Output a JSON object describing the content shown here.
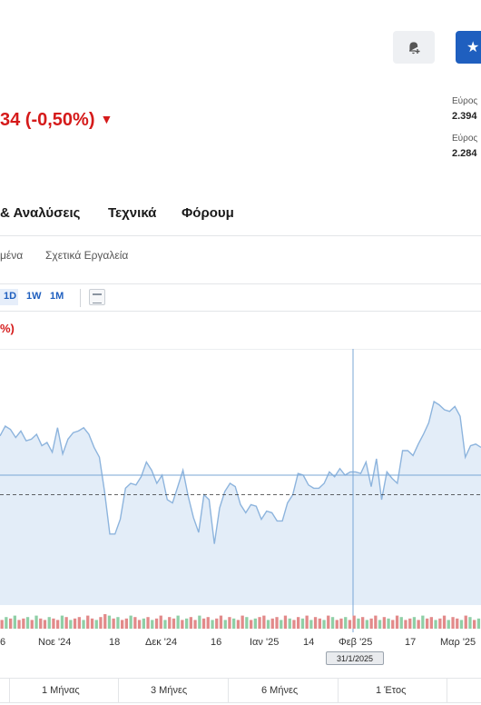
{
  "header": {
    "price_change": "34 (-0,50%)",
    "alert_icon": "bell-plus-icon",
    "watchlist_icon": "star-icon"
  },
  "side_stats": [
    {
      "label": "Εύρος",
      "value": "2.394"
    },
    {
      "label": "Εύρος",
      "value": "2.284"
    }
  ],
  "tabs": [
    "& Αναλύσεις",
    "Τεχνικά",
    "Φόρουμ"
  ],
  "subtabs": [
    "μένα",
    "Σχετικά Εργαλεία"
  ],
  "timeframes": [
    "1D",
    "1W",
    "1M"
  ],
  "chart_header": {
    "pct": "%)"
  },
  "crosshair_date": "31/1/2025",
  "x_axis": [
    "6",
    "Νοε '24",
    "18",
    "Δεκ '24",
    "16",
    "Ιαν '25",
    "14",
    "Φεβ '25",
    "17",
    "Μαρ '25"
  ],
  "ranges": [
    "1 Μήνας",
    "3 Μήνες",
    "6 Μήνες",
    "1 Έτος"
  ],
  "colors": {
    "up": "#2e9e5b",
    "down": "#d51a1a",
    "accent": "#1f5fbf",
    "line": "#7aa7d6"
  },
  "chart_data": {
    "type": "area",
    "title": "",
    "xlabel": "",
    "ylabel": "",
    "grid": false,
    "values": [
      69,
      75,
      73,
      68,
      72,
      66,
      67,
      70,
      63,
      65,
      59,
      74,
      58,
      67,
      71,
      72,
      74,
      70,
      62,
      56,
      35,
      9,
      9,
      18,
      37,
      40,
      39,
      44,
      53,
      48,
      40,
      45,
      30,
      28,
      38,
      48,
      32,
      19,
      10,
      33,
      30,
      3,
      25,
      35,
      40,
      38,
      27,
      22,
      27,
      26,
      18,
      23,
      22,
      17,
      17,
      28,
      33,
      46,
      45,
      39,
      37,
      37,
      40,
      47,
      44,
      49,
      45,
      47,
      47,
      46,
      53,
      38,
      55,
      30,
      47,
      43,
      40,
      60,
      60,
      57,
      64,
      70,
      77,
      90,
      88,
      85,
      84,
      87,
      81,
      56,
      63,
      64,
      62
    ],
    "previous_close": 33,
    "current": 45,
    "volume_colors": [
      "d",
      "u",
      "d",
      "u",
      "d",
      "d",
      "u",
      "d",
      "u",
      "d",
      "d",
      "u",
      "d",
      "d",
      "u",
      "d",
      "u",
      "d",
      "d",
      "u",
      "d",
      "d",
      "u",
      "d",
      "d",
      "u",
      "d",
      "u",
      "d",
      "d",
      "u",
      "d",
      "d",
      "u",
      "d",
      "u",
      "d",
      "d",
      "u",
      "d",
      "d",
      "u",
      "d",
      "u",
      "d",
      "d",
      "u",
      "d",
      "d",
      "u",
      "d",
      "d",
      "u",
      "d",
      "u",
      "d",
      "d",
      "u",
      "d",
      "u",
      "d",
      "d",
      "u",
      "d",
      "d",
      "u",
      "d",
      "u",
      "d",
      "d",
      "u",
      "d",
      "u",
      "d",
      "d",
      "u",
      "d",
      "u",
      "d",
      "d",
      "u",
      "d",
      "d",
      "u",
      "d",
      "u",
      "d",
      "d",
      "u",
      "d",
      "u",
      "d",
      "d",
      "u",
      "d",
      "d",
      "u",
      "d",
      "u",
      "d",
      "d",
      "u",
      "d",
      "d",
      "u",
      "d",
      "d",
      "u",
      "d",
      "u"
    ],
    "volume_heights": [
      0.6,
      0.8,
      0.7,
      0.9,
      0.6,
      0.7,
      0.8,
      0.6,
      0.9,
      0.7,
      0.6,
      0.8,
      0.7,
      0.6,
      0.9,
      0.8,
      0.6,
      0.7,
      0.8,
      0.6,
      0.9,
      0.7,
      0.6,
      0.8,
      1.0,
      0.9,
      0.7,
      0.8,
      0.6,
      0.7,
      0.9,
      0.8,
      0.6,
      0.7,
      0.8,
      0.6,
      0.7,
      0.9,
      0.6,
      0.8,
      0.7,
      0.9,
      0.6,
      0.7,
      0.8,
      0.6,
      0.9,
      0.7,
      0.8,
      0.6,
      0.7,
      0.9,
      0.6,
      0.8,
      0.7,
      0.6,
      0.9,
      0.8,
      0.6,
      0.7,
      0.8,
      0.9,
      0.6,
      0.7,
      0.8,
      0.6,
      0.9,
      0.7,
      0.6,
      0.8,
      0.7,
      0.9,
      0.6,
      0.8,
      0.7,
      0.6,
      0.9,
      0.8,
      0.6,
      0.7,
      0.8,
      0.6,
      0.9,
      0.7,
      0.8,
      0.6,
      0.7,
      0.9,
      0.6,
      0.8,
      0.7,
      0.6,
      0.9,
      0.8,
      0.6,
      0.7,
      0.8,
      0.6,
      0.9,
      0.7,
      0.8,
      0.6,
      0.7,
      0.9,
      0.6,
      0.8,
      0.7,
      0.6,
      0.9,
      0.8,
      0.6,
      0.7
    ]
  }
}
